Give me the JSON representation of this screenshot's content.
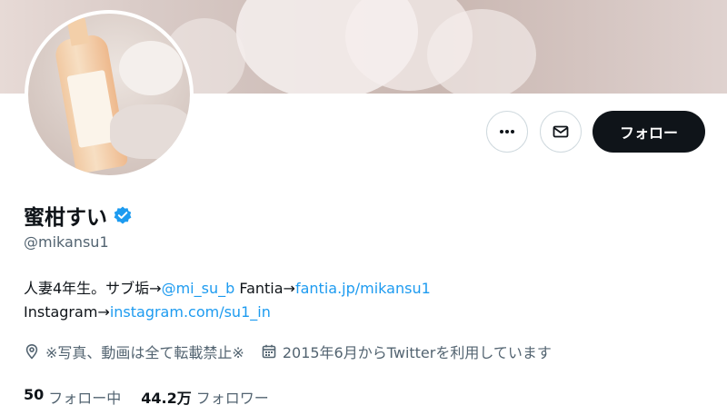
{
  "profile": {
    "name": "蜜柑すい",
    "handle": "@mikansu1",
    "bio_text_1": "人妻4年生。サブ垢→",
    "bio_link_1": "@mi_su_b",
    "bio_text_2": " Fantia→",
    "bio_link_2": "fantia.jp/mikansu1",
    "bio_text_3": "Instagram→",
    "bio_link_3": "instagram.com/su1_in",
    "location": "※写真、動画は全て転載禁止※",
    "joined": "2015年6月からTwitterを利用しています"
  },
  "actions": {
    "more_icon": "more-icon",
    "message_icon": "envelope-icon",
    "follow_label": "フォロー"
  },
  "stats": {
    "following_count": "50",
    "following_label": "フォロー中",
    "followers_count": "44.2万",
    "followers_label": "フォロワー"
  },
  "colors": {
    "link": "#1d9bf0",
    "verified": "#1d9bf0",
    "follow_button": "#0f1419",
    "secondary_text": "#536471"
  }
}
